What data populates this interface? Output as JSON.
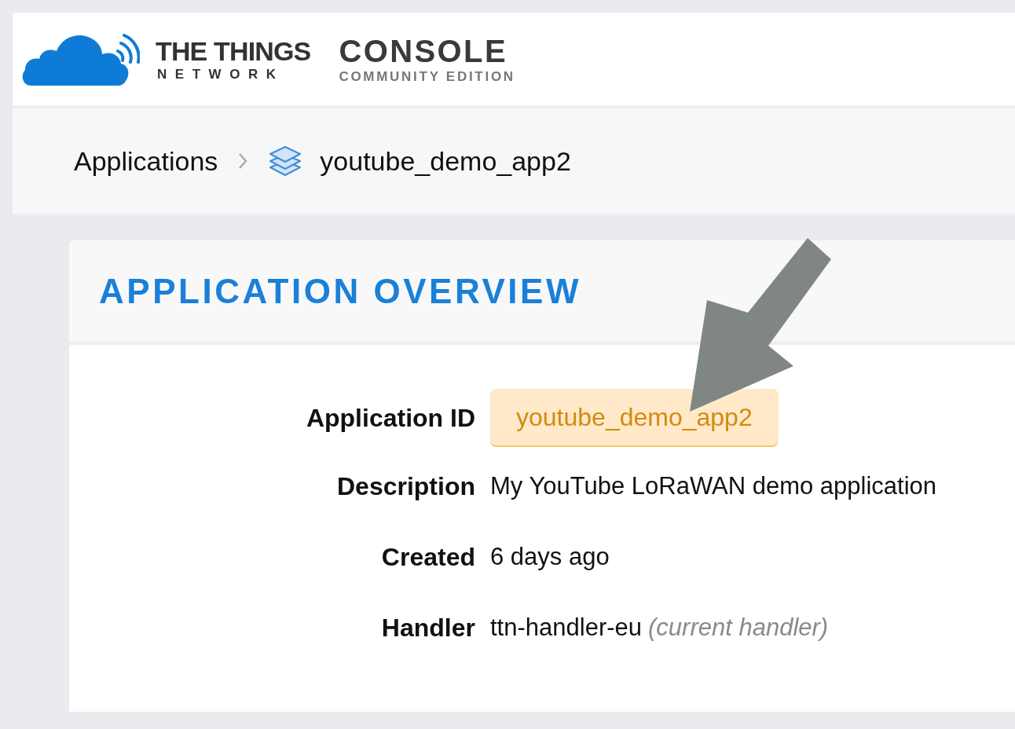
{
  "logo": {
    "name_top": "THE THINGS",
    "name_bottom": "NETWORK",
    "product": "CONSOLE",
    "edition": "COMMUNITY EDITION"
  },
  "breadcrumb": [
    {
      "label": "Applications",
      "kind": "link"
    },
    {
      "label": "youtube_demo_app2",
      "kind": "current"
    }
  ],
  "card": {
    "title": "APPLICATION OVERVIEW",
    "fields": [
      {
        "label": "Application ID",
        "value": "youtube_demo_app2",
        "kind": "badge"
      },
      {
        "label": "Description",
        "value": "My YouTube LoRaWAN demo application",
        "kind": "text"
      },
      {
        "label": "Created",
        "value": "6 days ago",
        "kind": "text"
      },
      {
        "label": "Handler",
        "value": "ttn-handler-eu",
        "note": "(current handler)",
        "kind": "text"
      }
    ]
  }
}
